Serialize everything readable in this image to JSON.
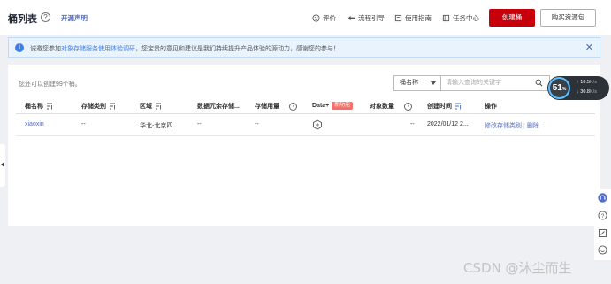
{
  "header": {
    "title": "桶列表",
    "oss_link": "开源声明",
    "toolbar": [
      {
        "label": "评价",
        "icon": "smile-icon"
      },
      {
        "label": "流程引导",
        "icon": "guide-icon"
      },
      {
        "label": "使用指南",
        "icon": "book-icon"
      },
      {
        "label": "任务中心",
        "icon": "task-icon"
      }
    ],
    "create_button": "创建桶",
    "buy_button": "购买资源包"
  },
  "notice": {
    "text_before": "诚邀您参加",
    "link": "对象存储服务使用体验调研",
    "text_after": "，您宝贵的意见和建议是我们持续提升产品体验的源动力，感谢您的参与！"
  },
  "list": {
    "count_text": "您还可以创建99个桶。",
    "filter_label": "桶名称",
    "search_placeholder": "请输入查询的关键字",
    "columns": {
      "name": "桶名称",
      "storage_class": "存储类别",
      "region": "区域",
      "redundancy": "数据冗余存储...",
      "usage": "存储用量",
      "data_plus": "Data+",
      "new_badge": "新功能",
      "object_count": "对象数量",
      "created": "创建时间",
      "ops": "操作"
    },
    "rows": [
      {
        "name": "xiaoxin",
        "storage_class": "--",
        "region": "华北-北京四",
        "redundancy": "--",
        "usage": "--",
        "object_count": "--",
        "created": "2022/01/12 2...",
        "op_modify": "修改存储类别",
        "op_delete": "删除"
      }
    ]
  },
  "float_widget": {
    "percent": "51",
    "unit": "%",
    "up": "10.5",
    "up_unit": "K/s",
    "down": "30.8",
    "down_unit": "K/s"
  },
  "watermark": "CSDN @沐尘而生",
  "colors": {
    "accent": "#c7000b",
    "link": "#526ecc",
    "notice_bg": "#e8f3fe",
    "badge": "#f66f6a"
  }
}
